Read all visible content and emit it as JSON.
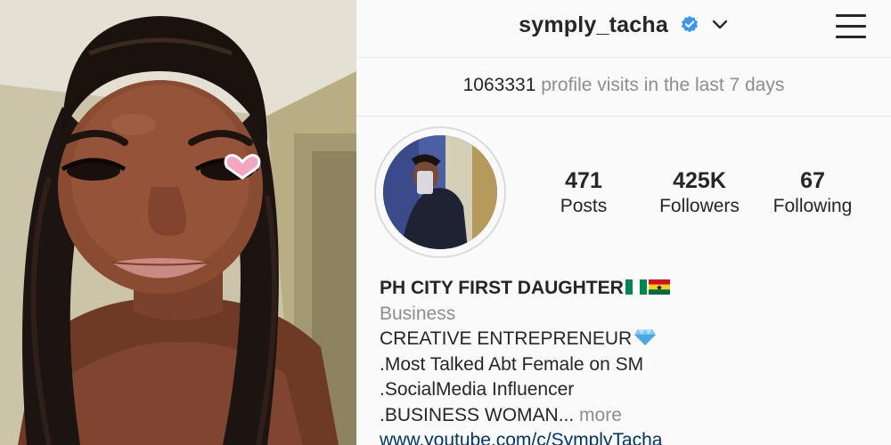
{
  "header": {
    "username": "symply_tacha"
  },
  "insights": {
    "visits_count": "1063331",
    "visits_text": "profile visits in the last 7 days"
  },
  "stats": {
    "posts_count": "471",
    "posts_label": "Posts",
    "followers_count": "425K",
    "followers_label": "Followers",
    "following_count": "67",
    "following_label": "Following"
  },
  "bio": {
    "name": "PH CITY FIRST DAUGHTER",
    "category": "Business",
    "line1": "CREATIVE ENTREPRENEUR",
    "line2": ".Most Talked Abt Female on SM",
    "line3": ".SocialMedia Influencer",
    "line4": ".BUSINESS WOMAN...",
    "more_label": "more",
    "website": "www.youtube.com/c/SymplyTacha"
  },
  "icons": {
    "verified": "verified-badge-icon",
    "dropdown": "chevron-down-icon",
    "menu": "hamburger-menu-icon",
    "flags": [
      "nigeria-flag-icon",
      "ghana-flag-icon"
    ],
    "gem": "gem-icon",
    "sticker": "heart-sticker-icon"
  },
  "colors": {
    "verified_blue": "#3897f0",
    "link": "#003569",
    "muted": "#8e8e8e",
    "text": "#262626"
  }
}
